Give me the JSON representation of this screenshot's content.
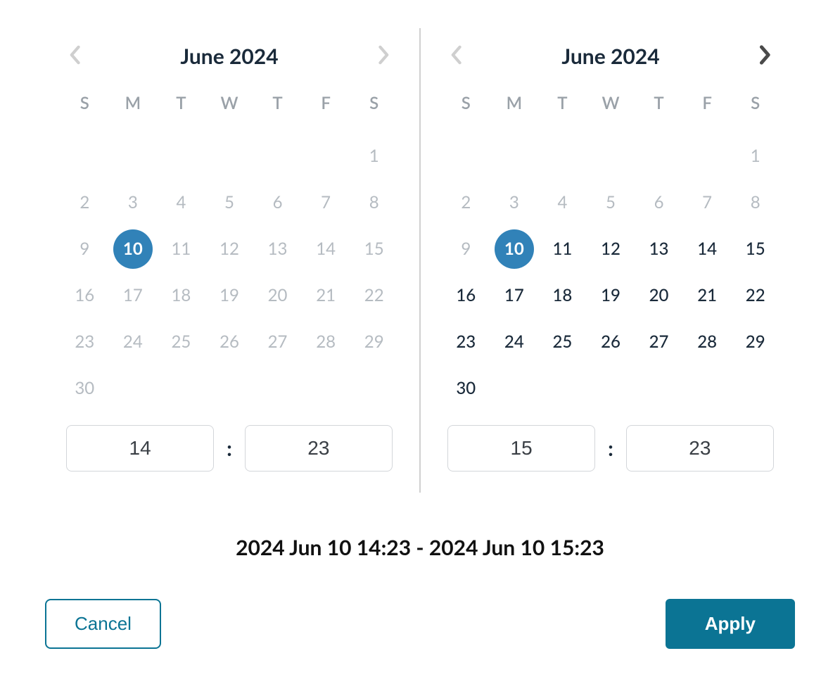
{
  "colors": {
    "accent": "#0b7494",
    "selected_day_bg": "#3182b8",
    "text_dark": "#1a2a3a",
    "text_muted": "#b5bbc1"
  },
  "weekdays": [
    "S",
    "M",
    "T",
    "W",
    "T",
    "F",
    "S"
  ],
  "left_calendar": {
    "title": "June 2024",
    "prev_enabled": false,
    "next_enabled": false,
    "leading_blanks": 6,
    "selected_day": 10,
    "days": [
      {
        "n": 1,
        "state": "dimmed"
      },
      {
        "n": 2,
        "state": "dimmed"
      },
      {
        "n": 3,
        "state": "dimmed"
      },
      {
        "n": 4,
        "state": "dimmed"
      },
      {
        "n": 5,
        "state": "dimmed"
      },
      {
        "n": 6,
        "state": "dimmed"
      },
      {
        "n": 7,
        "state": "dimmed"
      },
      {
        "n": 8,
        "state": "dimmed"
      },
      {
        "n": 9,
        "state": "dimmed"
      },
      {
        "n": 10,
        "state": "selected"
      },
      {
        "n": 11,
        "state": "dimmed"
      },
      {
        "n": 12,
        "state": "dimmed"
      },
      {
        "n": 13,
        "state": "dimmed"
      },
      {
        "n": 14,
        "state": "dimmed"
      },
      {
        "n": 15,
        "state": "dimmed"
      },
      {
        "n": 16,
        "state": "dimmed"
      },
      {
        "n": 17,
        "state": "dimmed"
      },
      {
        "n": 18,
        "state": "dimmed"
      },
      {
        "n": 19,
        "state": "dimmed"
      },
      {
        "n": 20,
        "state": "dimmed"
      },
      {
        "n": 21,
        "state": "dimmed"
      },
      {
        "n": 22,
        "state": "dimmed"
      },
      {
        "n": 23,
        "state": "dimmed"
      },
      {
        "n": 24,
        "state": "dimmed"
      },
      {
        "n": 25,
        "state": "dimmed"
      },
      {
        "n": 26,
        "state": "dimmed"
      },
      {
        "n": 27,
        "state": "dimmed"
      },
      {
        "n": 28,
        "state": "dimmed"
      },
      {
        "n": 29,
        "state": "dimmed"
      },
      {
        "n": 30,
        "state": "dimmed"
      }
    ],
    "time": {
      "hour": "14",
      "minute": "23"
    }
  },
  "right_calendar": {
    "title": "June 2024",
    "prev_enabled": false,
    "next_enabled": true,
    "leading_blanks": 6,
    "selected_day": 10,
    "days": [
      {
        "n": 1,
        "state": "dimmed"
      },
      {
        "n": 2,
        "state": "dimmed"
      },
      {
        "n": 3,
        "state": "dimmed"
      },
      {
        "n": 4,
        "state": "dimmed"
      },
      {
        "n": 5,
        "state": "dimmed"
      },
      {
        "n": 6,
        "state": "dimmed"
      },
      {
        "n": 7,
        "state": "dimmed"
      },
      {
        "n": 8,
        "state": "dimmed"
      },
      {
        "n": 9,
        "state": "dimmed"
      },
      {
        "n": 10,
        "state": "selected"
      },
      {
        "n": 11,
        "state": "normal"
      },
      {
        "n": 12,
        "state": "normal"
      },
      {
        "n": 13,
        "state": "normal"
      },
      {
        "n": 14,
        "state": "normal"
      },
      {
        "n": 15,
        "state": "normal"
      },
      {
        "n": 16,
        "state": "normal"
      },
      {
        "n": 17,
        "state": "normal"
      },
      {
        "n": 18,
        "state": "normal"
      },
      {
        "n": 19,
        "state": "normal"
      },
      {
        "n": 20,
        "state": "normal"
      },
      {
        "n": 21,
        "state": "normal"
      },
      {
        "n": 22,
        "state": "normal"
      },
      {
        "n": 23,
        "state": "normal"
      },
      {
        "n": 24,
        "state": "normal"
      },
      {
        "n": 25,
        "state": "normal"
      },
      {
        "n": 26,
        "state": "normal"
      },
      {
        "n": 27,
        "state": "normal"
      },
      {
        "n": 28,
        "state": "normal"
      },
      {
        "n": 29,
        "state": "normal"
      },
      {
        "n": 30,
        "state": "normal"
      }
    ],
    "time": {
      "hour": "15",
      "minute": "23"
    }
  },
  "range_summary": "2024 Jun 10 14:23 - 2024 Jun 10 15:23",
  "buttons": {
    "cancel": "Cancel",
    "apply": "Apply"
  }
}
